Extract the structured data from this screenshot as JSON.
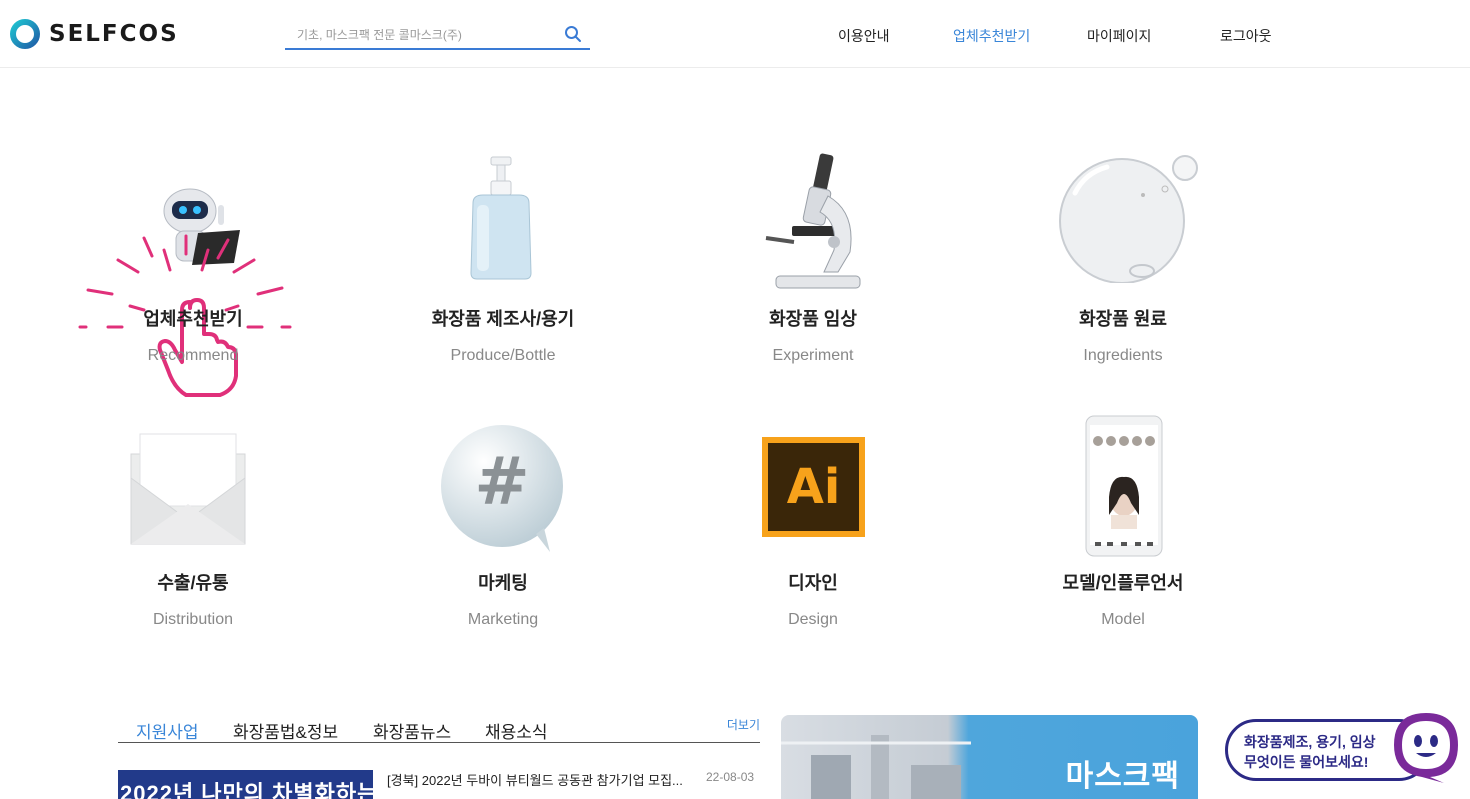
{
  "brand": {
    "name": "SELFCOS"
  },
  "search": {
    "placeholder": "기초, 마스크팩 전문 콜마스크(주)"
  },
  "nav": [
    {
      "label": "이용안내",
      "active": false
    },
    {
      "label": "업체추천받기",
      "active": true
    },
    {
      "label": "마이페이지",
      "active": false
    },
    {
      "label": "로그아웃",
      "active": false
    }
  ],
  "categories": [
    {
      "title": "업체추천받기",
      "subtitle": "Recommend"
    },
    {
      "title": "화장품 제조사/용기",
      "subtitle": "Produce/Bottle"
    },
    {
      "title": "화장품 임상",
      "subtitle": "Experiment"
    },
    {
      "title": "화장품 원료",
      "subtitle": "Ingredients"
    },
    {
      "title": "수출/유통",
      "subtitle": "Distribution"
    },
    {
      "title": "마케팅",
      "subtitle": "Marketing"
    },
    {
      "title": "디자인",
      "subtitle": "Design"
    },
    {
      "title": "모델/인플루언서",
      "subtitle": "Model"
    }
  ],
  "icons": {
    "design_icon_text": "Ai",
    "marketing_icon_text": "#"
  },
  "news": {
    "tabs": [
      "지원사업",
      "화장품법&정보",
      "화장품뉴스",
      "채용소식"
    ],
    "active_tab": 0,
    "more_label": "더보기",
    "items": [
      {
        "thumb_text": "2022년 나만의 차별화하는",
        "title": "[경북] 2022년 두바이 뷰티월드 공동관 참가기업 모집...",
        "date": "22-08-03"
      }
    ]
  },
  "banner": {
    "text": "마스크팩"
  },
  "chat": {
    "line1": "화장품제조, 용기, 임상",
    "line2": "무엇이든 물어보세요!"
  },
  "colors": {
    "accent": "#3a86d8",
    "chat": "#2c2a86",
    "pointer": "#e0307a",
    "logo": "#1aa4c4"
  }
}
